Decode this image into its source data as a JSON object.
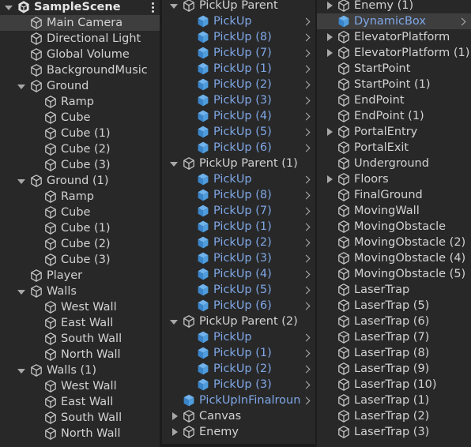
{
  "colors": {
    "panel_bg": "#282828",
    "prefab_blue": "#7fa7e6",
    "selected_bg": "#3e3e3e",
    "text": "#d2d2d2"
  },
  "panel1": {
    "rows": [
      {
        "label": "SampleScene",
        "depth": 0,
        "arrow": "down",
        "icon": "unity-scene-icon",
        "bold": true,
        "kebab": true
      },
      {
        "label": "Main Camera",
        "depth": 1,
        "icon": "gameobject-icon",
        "highlighted": true
      },
      {
        "label": "Directional Light",
        "depth": 1,
        "icon": "gameobject-icon"
      },
      {
        "label": "Global Volume",
        "depth": 1,
        "icon": "gameobject-icon"
      },
      {
        "label": "BackgroundMusic",
        "depth": 1,
        "icon": "gameobject-icon"
      },
      {
        "label": "Ground",
        "depth": 1,
        "arrow": "down",
        "icon": "gameobject-icon"
      },
      {
        "label": "Ramp",
        "depth": 2,
        "icon": "gameobject-icon"
      },
      {
        "label": "Cube",
        "depth": 2,
        "icon": "gameobject-icon"
      },
      {
        "label": "Cube (1)",
        "depth": 2,
        "icon": "gameobject-icon"
      },
      {
        "label": "Cube (2)",
        "depth": 2,
        "icon": "gameobject-icon"
      },
      {
        "label": "Cube (3)",
        "depth": 2,
        "icon": "gameobject-icon"
      },
      {
        "label": "Ground (1)",
        "depth": 1,
        "arrow": "down",
        "icon": "gameobject-icon"
      },
      {
        "label": "Ramp",
        "depth": 2,
        "icon": "gameobject-icon"
      },
      {
        "label": "Cube",
        "depth": 2,
        "icon": "gameobject-icon"
      },
      {
        "label": "Cube (1)",
        "depth": 2,
        "icon": "gameobject-icon"
      },
      {
        "label": "Cube (2)",
        "depth": 2,
        "icon": "gameobject-icon"
      },
      {
        "label": "Cube (3)",
        "depth": 2,
        "icon": "gameobject-icon"
      },
      {
        "label": "Player",
        "depth": 1,
        "icon": "gameobject-icon"
      },
      {
        "label": "Walls",
        "depth": 1,
        "arrow": "down",
        "icon": "gameobject-icon"
      },
      {
        "label": "West Wall",
        "depth": 2,
        "icon": "gameobject-icon"
      },
      {
        "label": "East Wall",
        "depth": 2,
        "icon": "gameobject-icon"
      },
      {
        "label": "South Wall",
        "depth": 2,
        "icon": "gameobject-icon"
      },
      {
        "label": "North Wall",
        "depth": 2,
        "icon": "gameobject-icon"
      },
      {
        "label": "Walls (1)",
        "depth": 1,
        "arrow": "down",
        "icon": "gameobject-icon"
      },
      {
        "label": "West Wall",
        "depth": 2,
        "icon": "gameobject-icon"
      },
      {
        "label": "East Wall",
        "depth": 2,
        "icon": "gameobject-icon"
      },
      {
        "label": "South Wall",
        "depth": 2,
        "icon": "gameobject-icon"
      },
      {
        "label": "North Wall",
        "depth": 2,
        "icon": "gameobject-icon"
      }
    ]
  },
  "panel2": {
    "rows": [
      {
        "label": "PickUp Parent",
        "depth": 0,
        "arrow": "down",
        "icon": "gameobject-icon"
      },
      {
        "label": "PickUp",
        "depth": 1,
        "icon": "prefab-cube-icon",
        "prefab": true,
        "chevron": true
      },
      {
        "label": "PickUp (8)",
        "depth": 1,
        "icon": "prefab-cube-icon",
        "prefab": true,
        "chevron": true
      },
      {
        "label": "PickUp (7)",
        "depth": 1,
        "icon": "prefab-cube-icon",
        "prefab": true,
        "chevron": true
      },
      {
        "label": "PickUp (1)",
        "depth": 1,
        "icon": "prefab-cube-icon",
        "prefab": true,
        "chevron": true
      },
      {
        "label": "PickUp (2)",
        "depth": 1,
        "icon": "prefab-cube-icon",
        "prefab": true,
        "chevron": true
      },
      {
        "label": "PickUp (3)",
        "depth": 1,
        "icon": "prefab-cube-icon",
        "prefab": true,
        "chevron": true
      },
      {
        "label": "PickUp (4)",
        "depth": 1,
        "icon": "prefab-cube-icon",
        "prefab": true,
        "chevron": true
      },
      {
        "label": "PickUp (5)",
        "depth": 1,
        "icon": "prefab-cube-icon",
        "prefab": true,
        "chevron": true
      },
      {
        "label": "PickUp (6)",
        "depth": 1,
        "icon": "prefab-cube-icon",
        "prefab": true,
        "chevron": true
      },
      {
        "label": "PickUp Parent (1)",
        "depth": 0,
        "arrow": "down",
        "icon": "gameobject-icon"
      },
      {
        "label": "PickUp",
        "depth": 1,
        "icon": "prefab-cube-icon",
        "prefab": true,
        "chevron": true
      },
      {
        "label": "PickUp (8)",
        "depth": 1,
        "icon": "prefab-cube-icon",
        "prefab": true,
        "chevron": true
      },
      {
        "label": "PickUp (7)",
        "depth": 1,
        "icon": "prefab-cube-icon",
        "prefab": true,
        "chevron": true
      },
      {
        "label": "PickUp (1)",
        "depth": 1,
        "icon": "prefab-cube-icon",
        "prefab": true,
        "chevron": true
      },
      {
        "label": "PickUp (2)",
        "depth": 1,
        "icon": "prefab-cube-icon",
        "prefab": true,
        "chevron": true
      },
      {
        "label": "PickUp (3)",
        "depth": 1,
        "icon": "prefab-cube-icon",
        "prefab": true,
        "chevron": true
      },
      {
        "label": "PickUp (4)",
        "depth": 1,
        "icon": "prefab-cube-icon",
        "prefab": true,
        "chevron": true
      },
      {
        "label": "PickUp (5)",
        "depth": 1,
        "icon": "prefab-cube-icon",
        "prefab": true,
        "chevron": true
      },
      {
        "label": "PickUp (6)",
        "depth": 1,
        "icon": "prefab-cube-icon",
        "prefab": true,
        "chevron": true
      },
      {
        "label": "PickUp Parent (2)",
        "depth": 0,
        "arrow": "down",
        "icon": "gameobject-icon"
      },
      {
        "label": "PickUp",
        "depth": 1,
        "icon": "prefab-cube-icon",
        "prefab": true,
        "chevron": true
      },
      {
        "label": "PickUp (1)",
        "depth": 1,
        "icon": "prefab-cube-icon",
        "prefab": true,
        "chevron": true
      },
      {
        "label": "PickUp (2)",
        "depth": 1,
        "icon": "prefab-cube-icon",
        "prefab": true,
        "chevron": true
      },
      {
        "label": "PickUp (3)",
        "depth": 1,
        "icon": "prefab-cube-icon",
        "prefab": true,
        "chevron": true
      },
      {
        "label": "PickUpInFinalroun",
        "depth": 0,
        "icon": "prefab-cube-icon",
        "prefab": true,
        "chevron": true
      },
      {
        "label": "Canvas",
        "depth": 0,
        "arrow": "right",
        "icon": "gameobject-icon"
      },
      {
        "label": "Enemy",
        "depth": 0,
        "arrow": "right",
        "icon": "gameobject-icon"
      }
    ]
  },
  "panel3": {
    "rows": [
      {
        "label": "Enemy (1)",
        "depth": 0,
        "arrow": "right",
        "icon": "gameobject-icon"
      },
      {
        "label": "DynamicBox",
        "depth": 0,
        "icon": "prefab-cube-icon",
        "prefab": true,
        "chevron": true,
        "highlighted": true
      },
      {
        "label": "ElevatorPlatform",
        "depth": 0,
        "arrow": "right",
        "icon": "gameobject-icon"
      },
      {
        "label": "ElevatorPlatform (1)",
        "depth": 0,
        "arrow": "right",
        "icon": "gameobject-icon"
      },
      {
        "label": "StartPoint",
        "depth": 0,
        "icon": "gameobject-icon"
      },
      {
        "label": "StartPoint (1)",
        "depth": 0,
        "icon": "gameobject-icon"
      },
      {
        "label": "EndPoint",
        "depth": 0,
        "icon": "gameobject-icon"
      },
      {
        "label": "EndPoint (1)",
        "depth": 0,
        "icon": "gameobject-icon"
      },
      {
        "label": "PortalEntry",
        "depth": 0,
        "arrow": "right",
        "icon": "gameobject-icon"
      },
      {
        "label": "PortalExit",
        "depth": 0,
        "icon": "gameobject-icon"
      },
      {
        "label": "Underground",
        "depth": 0,
        "icon": "gameobject-icon"
      },
      {
        "label": "Floors",
        "depth": 0,
        "arrow": "right",
        "icon": "gameobject-icon"
      },
      {
        "label": "FinalGround",
        "depth": 0,
        "icon": "gameobject-icon"
      },
      {
        "label": "MovingWall",
        "depth": 0,
        "icon": "gameobject-icon"
      },
      {
        "label": "MovingObstacle",
        "depth": 0,
        "icon": "gameobject-icon"
      },
      {
        "label": "MovingObstacle (2)",
        "depth": 0,
        "icon": "gameobject-icon"
      },
      {
        "label": "MovingObstacle (4)",
        "depth": 0,
        "icon": "gameobject-icon"
      },
      {
        "label": "MovingObstacle (5)",
        "depth": 0,
        "icon": "gameobject-icon"
      },
      {
        "label": "LaserTrap",
        "depth": 0,
        "icon": "gameobject-icon"
      },
      {
        "label": "LaserTrap (5)",
        "depth": 0,
        "icon": "gameobject-icon"
      },
      {
        "label": "LaserTrap (6)",
        "depth": 0,
        "icon": "gameobject-icon"
      },
      {
        "label": "LaserTrap (7)",
        "depth": 0,
        "icon": "gameobject-icon"
      },
      {
        "label": "LaserTrap (8)",
        "depth": 0,
        "icon": "gameobject-icon"
      },
      {
        "label": "LaserTrap (9)",
        "depth": 0,
        "icon": "gameobject-icon"
      },
      {
        "label": "LaserTrap (10)",
        "depth": 0,
        "icon": "gameobject-icon"
      },
      {
        "label": "LaserTrap (1)",
        "depth": 0,
        "icon": "gameobject-icon"
      },
      {
        "label": "LaserTrap (2)",
        "depth": 0,
        "icon": "gameobject-icon"
      },
      {
        "label": "LaserTrap (3)",
        "depth": 0,
        "icon": "gameobject-icon"
      }
    ]
  }
}
